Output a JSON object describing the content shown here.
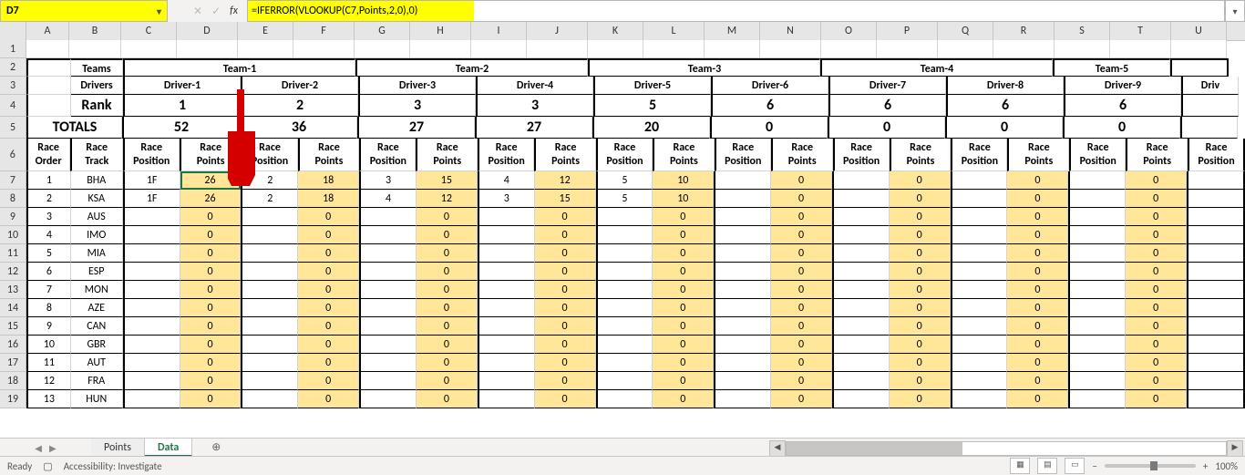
{
  "name_box": "D7",
  "formula": "=IFERROR(VLOOKUP(C7,Points,2,0),0)",
  "columns": [
    "A",
    "B",
    "C",
    "D",
    "E",
    "F",
    "G",
    "H",
    "I",
    "J",
    "K",
    "L",
    "M",
    "N",
    "O",
    "P",
    "Q",
    "R",
    "S",
    "T",
    "U"
  ],
  "col_widths": [
    "wA",
    "wB",
    "wC",
    "wD",
    "wE",
    "wF",
    "wG",
    "wH",
    "wI",
    "wJ",
    "wK",
    "wL",
    "wM",
    "wN",
    "wO",
    "wP",
    "wQ",
    "wR",
    "wS",
    "wT",
    "wU"
  ],
  "labels": {
    "teams": "Teams",
    "drivers": "Drivers",
    "rank": "Rank",
    "totals": "TOTALS",
    "race_order": "Race\nOrder",
    "race_track": "Race\nTrack",
    "race_pos": "Race\nPosition",
    "race_pts": "Race\nPoints"
  },
  "teams": [
    "Team-1",
    "Team-2",
    "Team-3",
    "Team-4",
    "Team-5"
  ],
  "drivers": [
    "Driver-1",
    "Driver-2",
    "Driver-3",
    "Driver-4",
    "Driver-5",
    "Driver-6",
    "Driver-7",
    "Driver-8",
    "Driver-9",
    "Driv"
  ],
  "ranks": [
    "1",
    "2",
    "3",
    "3",
    "5",
    "6",
    "6",
    "6",
    "6",
    ""
  ],
  "totals": [
    "52",
    "36",
    "27",
    "27",
    "20",
    "0",
    "0",
    "0",
    "0",
    ""
  ],
  "tracks": [
    "BHA",
    "KSA",
    "AUS",
    "IMO",
    "MIA",
    "ESP",
    "MON",
    "AZE",
    "CAN",
    "GBR",
    "AUT",
    "FRA",
    "HUN"
  ],
  "race_order": [
    "1",
    "2",
    "3",
    "4",
    "5",
    "6",
    "7",
    "8",
    "9",
    "10",
    "11",
    "12",
    "13"
  ],
  "row_numbers_start": 7,
  "data_rows": [
    {
      "pos": [
        "1F",
        "2",
        "3",
        "4",
        "5",
        "",
        "",
        "",
        "",
        ""
      ],
      "pts": [
        "26",
        "18",
        "15",
        "12",
        "10",
        "0",
        "0",
        "0",
        "0",
        ""
      ]
    },
    {
      "pos": [
        "1F",
        "2",
        "4",
        "3",
        "5",
        "",
        "",
        "",
        "",
        ""
      ],
      "pts": [
        "26",
        "18",
        "12",
        "15",
        "10",
        "0",
        "0",
        "0",
        "0",
        ""
      ]
    },
    {
      "pos": [
        "",
        "",
        "",
        "",
        "",
        "",
        "",
        "",
        "",
        ""
      ],
      "pts": [
        "0",
        "0",
        "0",
        "0",
        "0",
        "0",
        "0",
        "0",
        "0",
        ""
      ]
    },
    {
      "pos": [
        "",
        "",
        "",
        "",
        "",
        "",
        "",
        "",
        "",
        ""
      ],
      "pts": [
        "0",
        "0",
        "0",
        "0",
        "0",
        "0",
        "0",
        "0",
        "0",
        ""
      ]
    },
    {
      "pos": [
        "",
        "",
        "",
        "",
        "",
        "",
        "",
        "",
        "",
        ""
      ],
      "pts": [
        "0",
        "0",
        "0",
        "0",
        "0",
        "0",
        "0",
        "0",
        "0",
        ""
      ]
    },
    {
      "pos": [
        "",
        "",
        "",
        "",
        "",
        "",
        "",
        "",
        "",
        ""
      ],
      "pts": [
        "0",
        "0",
        "0",
        "0",
        "0",
        "0",
        "0",
        "0",
        "0",
        ""
      ]
    },
    {
      "pos": [
        "",
        "",
        "",
        "",
        "",
        "",
        "",
        "",
        "",
        ""
      ],
      "pts": [
        "0",
        "0",
        "0",
        "0",
        "0",
        "0",
        "0",
        "0",
        "0",
        ""
      ]
    },
    {
      "pos": [
        "",
        "",
        "",
        "",
        "",
        "",
        "",
        "",
        "",
        ""
      ],
      "pts": [
        "0",
        "0",
        "0",
        "0",
        "0",
        "0",
        "0",
        "0",
        "0",
        ""
      ]
    },
    {
      "pos": [
        "",
        "",
        "",
        "",
        "",
        "",
        "",
        "",
        "",
        ""
      ],
      "pts": [
        "0",
        "0",
        "0",
        "0",
        "0",
        "0",
        "0",
        "0",
        "0",
        ""
      ]
    },
    {
      "pos": [
        "",
        "",
        "",
        "",
        "",
        "",
        "",
        "",
        "",
        ""
      ],
      "pts": [
        "0",
        "0",
        "0",
        "0",
        "0",
        "0",
        "0",
        "0",
        "0",
        ""
      ]
    },
    {
      "pos": [
        "",
        "",
        "",
        "",
        "",
        "",
        "",
        "",
        "",
        ""
      ],
      "pts": [
        "0",
        "0",
        "0",
        "0",
        "0",
        "0",
        "0",
        "0",
        "0",
        ""
      ]
    },
    {
      "pos": [
        "",
        "",
        "",
        "",
        "",
        "",
        "",
        "",
        "",
        ""
      ],
      "pts": [
        "0",
        "0",
        "0",
        "0",
        "0",
        "0",
        "0",
        "0",
        "0",
        ""
      ]
    },
    {
      "pos": [
        "",
        "",
        "",
        "",
        "",
        "",
        "",
        "",
        "",
        ""
      ],
      "pts": [
        "0",
        "0",
        "0",
        "0",
        "0",
        "0",
        "0",
        "0",
        "0",
        ""
      ]
    }
  ],
  "tabs": {
    "points": "Points",
    "data": "Data"
  },
  "status": {
    "ready": "Ready",
    "access": "Accessibility: Investigate",
    "zoom": "100%"
  },
  "icons": {
    "cancel": "✕",
    "enter": "✓",
    "fx": "fx",
    "chev_down": "▾",
    "tri_l": "◀",
    "tri_r": "▶",
    "plus": "⊕",
    "minus": "−",
    "plus2": "+"
  }
}
